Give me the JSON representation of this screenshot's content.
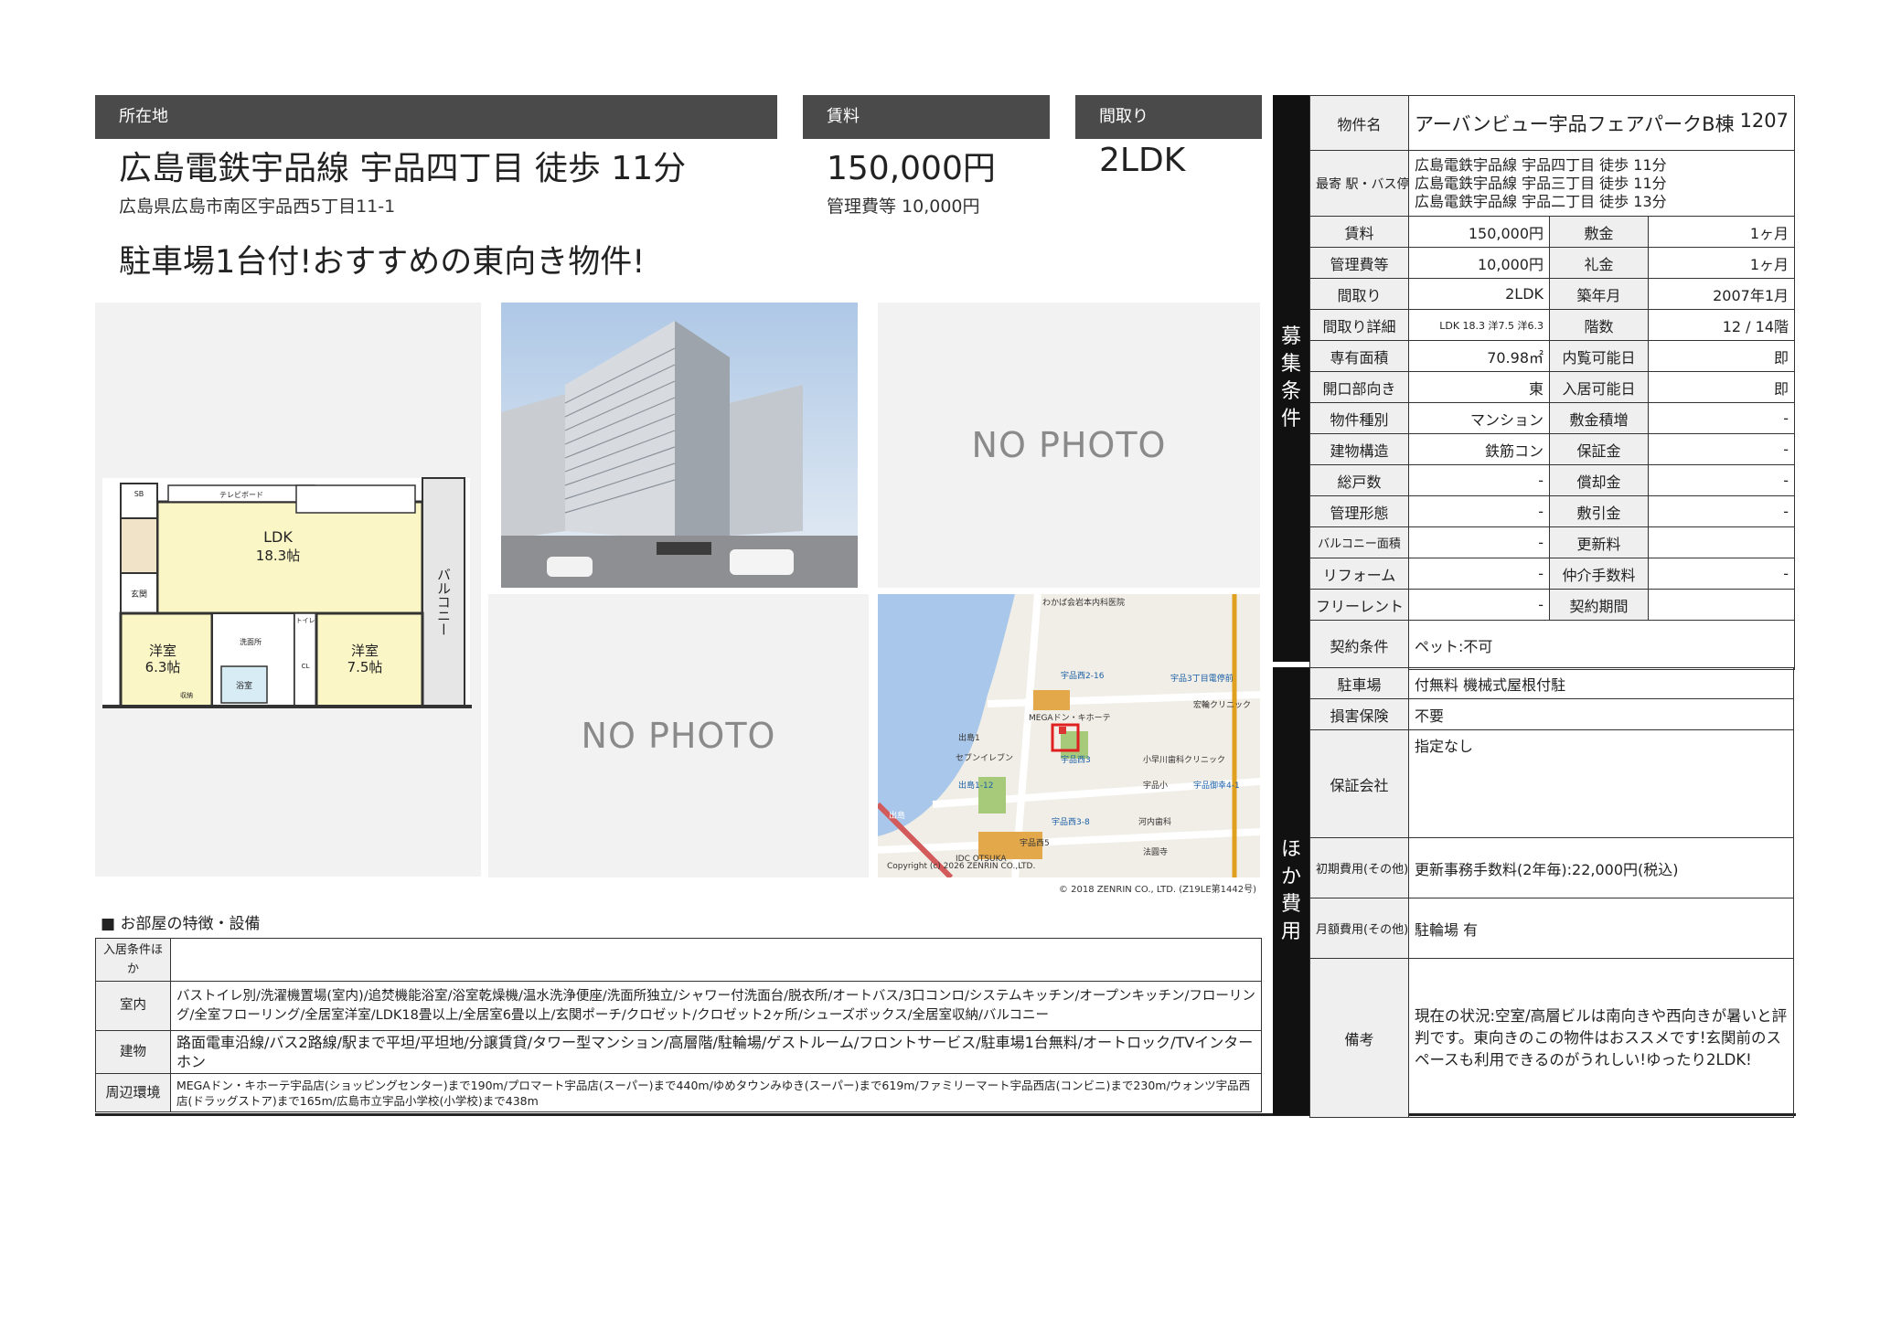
{
  "location": {
    "label": "所在地",
    "station_line": "広島電鉄宇品線 宇品四丁目 徒歩 11分",
    "address": "広島県広島市南区宇品西5丁目11-1"
  },
  "rent": {
    "label": "賃料",
    "value": "150,000円",
    "fee": "管理費等 10,000円"
  },
  "layout": {
    "label": "間取り",
    "value": "2LDK"
  },
  "catchcopy": "駐車場1台付!おすすめの東向き物件!",
  "photos": {
    "nophoto_text": "NO PHOTO",
    "map_copyright": "© 2018 ZENRIN CO., LTD. (Z19LE第1442号)",
    "map_inner_copyright": "Copyright (c) 2026 ZENRIN CO.,LTD.",
    "floorplan": {
      "ldk": "LDK",
      "ldk_size": "18.3帖",
      "room1": "洋室",
      "room1_size": "6.3帖",
      "room2": "洋室",
      "room2_size": "7.5帖",
      "balcony": "バルコニー",
      "sb": "SB",
      "tv": "テレビボード",
      "entrance": "玄関",
      "wash": "洗面所",
      "bath": "浴室",
      "toilet": "トイレ",
      "storage": "収納",
      "cl": "CL"
    },
    "map_labels": [
      "わかば会岩本内科医院",
      "宇品西2-16",
      "宇品3丁目電停前",
      "MEGAドン・キホーテ",
      "出島1",
      "宇品西3",
      "小早川歯科クリニック",
      "出島1-12",
      "宇品小",
      "宇品御幸4-1",
      "宇品西3-8",
      "河内歯科",
      "宇品西5",
      "出島",
      "IDC OTSUKA",
      "法圓寺",
      "セブンイレブン",
      "宏輪クリニック"
    ]
  },
  "features": {
    "title": "■ お部屋の特徴・設備",
    "rows": [
      {
        "label": "入居条件ほか",
        "value": ""
      },
      {
        "label": "室内",
        "value": "バストイレ別/洗濯機置場(室内)/追焚機能浴室/浴室乾燥機/温水洗浄便座/洗面所独立/シャワー付洗面台/脱衣所/オートバス/3口コンロ/システムキッチン/オープンキッチン/フローリング/全室フローリング/全居室洋室/LDK18畳以上/全居室6畳以上/玄関ポーチ/クロゼット/クロゼット2ヶ所/シューズボックス/全居室収納/バルコニー"
      },
      {
        "label": "建物",
        "value": "路面電車沿線/バス2路線/駅まで平坦/平坦地/分譲賃貸/タワー型マンション/高層階/駐輪場/ゲストルーム/フロントサービス/駐車場1台無料/オートロック/TVインターホン"
      },
      {
        "label": "周辺環境",
        "value": "MEGAドン・キホーテ宇品店(ショッピングセンター)まで190m/プロマート宇品店(スーパー)まで440m/ゆめタウンみゆき(スーパー)まで619m/ファミリーマート宇品西店(コンビニ)まで230m/ウォンツ宇品西店(ドラッグストア)まで165m/広島市立宇品小学校(小学校)まで438m"
      }
    ]
  },
  "conditions": {
    "side_label": [
      "募",
      "集",
      "条",
      "件"
    ],
    "property_name_label": "物件名",
    "property_name": "アーバンビュー宇品フェアパークB棟",
    "room_number": "1207",
    "nearest_label": "最寄 駅・バス停",
    "nearest": [
      "広島電鉄宇品線 宇品四丁目 徒歩 11分",
      "広島電鉄宇品線 宇品三丁目 徒歩 11分",
      "広島電鉄宇品線 宇品二丁目 徒歩 13分"
    ],
    "rows": [
      {
        "l1": "賃料",
        "v1": "150,000円",
        "l2": "敷金",
        "v2": "1ヶ月"
      },
      {
        "l1": "管理費等",
        "v1": "10,000円",
        "l2": "礼金",
        "v2": "1ヶ月"
      },
      {
        "l1": "間取り",
        "v1": "2LDK",
        "l2": "築年月",
        "v2": "2007年1月"
      },
      {
        "l1": "間取り詳細",
        "v1": "LDK 18.3 洋7.5 洋6.3",
        "l2": "階数",
        "v2": "12 / 14階"
      },
      {
        "l1": "専有面積",
        "v1": "70.98㎡",
        "l2": "内覧可能日",
        "v2": "即"
      },
      {
        "l1": "開口部向き",
        "v1": "東",
        "l2": "入居可能日",
        "v2": "即"
      },
      {
        "l1": "物件種別",
        "v1": "マンション",
        "l2": "敷金積増",
        "v2": "-"
      },
      {
        "l1": "建物構造",
        "v1": "鉄筋コン",
        "l2": "保証金",
        "v2": "-"
      },
      {
        "l1": "総戸数",
        "v1": "-",
        "l2": "償却金",
        "v2": "-"
      },
      {
        "l1": "管理形態",
        "v1": "-",
        "l2": "敷引金",
        "v2": "-"
      },
      {
        "l1": "バルコニー面積",
        "v1": "-",
        "l2": "更新料",
        "v2": ""
      },
      {
        "l1": "リフォーム",
        "v1": "-",
        "l2": "仲介手数料",
        "v2": "-"
      },
      {
        "l1": "フリーレント",
        "v1": "-",
        "l2": "契約期間",
        "v2": ""
      }
    ],
    "contract_label": "契約条件",
    "contract_value": "ペット:不可"
  },
  "costs": {
    "side_label": [
      "ほ",
      "か",
      "費",
      "用"
    ],
    "rows": [
      {
        "label": "駐車場",
        "value": "付無料 機械式屋根付駐"
      },
      {
        "label": "損害保険",
        "value": "不要"
      },
      {
        "label": "保証会社",
        "value": "指定なし"
      },
      {
        "label": "初期費用(その他)",
        "value": "更新事務手数料(2年毎):22,000円(税込)"
      },
      {
        "label": "月額費用(その他)",
        "value": "駐輪場 有"
      },
      {
        "label": "備考",
        "value": "現在の状況:空室/高層ビルは南向きや西向きが暑いと評判です。東向きのこの物件はおススメです!玄関前のスペースも利用できるのがうれしい!ゆったり2LDK!"
      }
    ]
  }
}
